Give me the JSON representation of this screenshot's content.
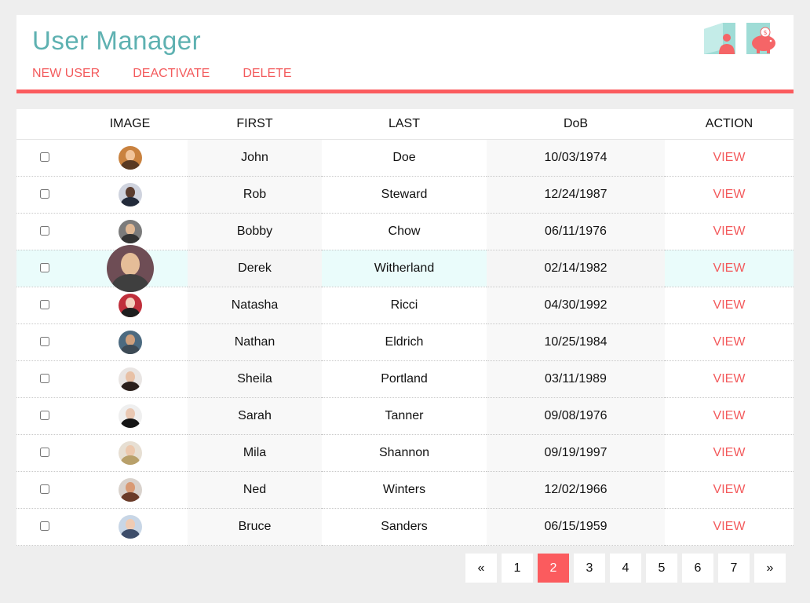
{
  "header": {
    "title": "User Manager",
    "actions": [
      "NEW USER",
      "DEACTIVATE",
      "DELETE"
    ],
    "icons": [
      "user-profile-icon",
      "piggy-bank-icon"
    ]
  },
  "table": {
    "columns": [
      "",
      "IMAGE",
      "FIRST",
      "LAST",
      "DoB",
      "ACTION"
    ],
    "rows": [
      {
        "first": "John",
        "last": "Doe",
        "dob": "10/03/1974",
        "action": "VIEW",
        "avatar": {
          "bg": "#c9823f",
          "face": "#f1c49a",
          "body": "#5a3a22"
        }
      },
      {
        "first": "Rob",
        "last": "Steward",
        "dob": "12/24/1987",
        "action": "VIEW",
        "avatar": {
          "bg": "#cfd3de",
          "face": "#5a3c2e",
          "body": "#222a3a"
        }
      },
      {
        "first": "Bobby",
        "last": "Chow",
        "dob": "06/11/1976",
        "action": "VIEW",
        "avatar": {
          "bg": "#7b7b7b",
          "face": "#e0b894",
          "body": "#333333"
        }
      },
      {
        "first": "Derek",
        "last": "Witherland",
        "dob": "02/14/1982",
        "action": "VIEW",
        "highlighted": true,
        "avatar": {
          "bg": "#6e4d55",
          "face": "#e5bd98",
          "body": "#3f3f3f"
        }
      },
      {
        "first": "Natasha",
        "last": "Ricci",
        "dob": "04/30/1992",
        "action": "VIEW",
        "avatar": {
          "bg": "#c02f3b",
          "face": "#f3d0bd",
          "body": "#1e1e1e"
        }
      },
      {
        "first": "Nathan",
        "last": "Eldrich",
        "dob": "10/25/1984",
        "action": "VIEW",
        "avatar": {
          "bg": "#4c6a80",
          "face": "#cfa07d",
          "body": "#3d4a55"
        }
      },
      {
        "first": "Sheila",
        "last": "Portland",
        "dob": "03/11/1989",
        "action": "VIEW",
        "avatar": {
          "bg": "#e9e5e3",
          "face": "#e8c1a6",
          "body": "#2a1f1b"
        }
      },
      {
        "first": "Sarah",
        "last": "Tanner",
        "dob": "09/08/1976",
        "action": "VIEW",
        "avatar": {
          "bg": "#efefef",
          "face": "#e9c8b3",
          "body": "#141414"
        }
      },
      {
        "first": "Mila",
        "last": "Shannon",
        "dob": "09/19/1997",
        "action": "VIEW",
        "avatar": {
          "bg": "#e7dfd3",
          "face": "#ecc8ad",
          "body": "#b8a06a"
        }
      },
      {
        "first": "Ned",
        "last": "Winters",
        "dob": "12/02/1966",
        "action": "VIEW",
        "avatar": {
          "bg": "#d9d2cc",
          "face": "#d99a74",
          "body": "#6a3b28"
        }
      },
      {
        "first": "Bruce",
        "last": "Sanders",
        "dob": "06/15/1959",
        "action": "VIEW",
        "avatar": {
          "bg": "#c8d6e6",
          "face": "#efcbb3",
          "body": "#3d4d6a"
        }
      }
    ]
  },
  "pagination": {
    "prev": "«",
    "pages": [
      "1",
      "2",
      "3",
      "4",
      "5",
      "6",
      "7"
    ],
    "current": "2",
    "next": "»"
  },
  "colors": {
    "accent": "#fb5b5e",
    "title": "#5eb1b1",
    "highlight_row": "#eafcfb"
  }
}
